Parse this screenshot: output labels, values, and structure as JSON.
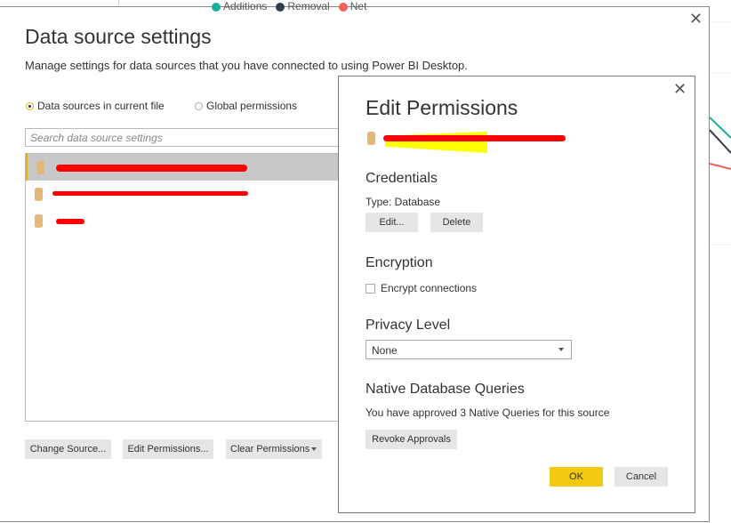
{
  "background": {
    "legend": [
      {
        "label": "Additions",
        "color": "#1aaf9c"
      },
      {
        "label": "Removal",
        "color": "#333d47"
      },
      {
        "label": "Net",
        "color": "#f0605a"
      }
    ]
  },
  "dialog": {
    "title": "Data source settings",
    "description": "Manage settings for data sources that you have connected to using Power BI Desktop.",
    "radios": [
      {
        "label": "Data sources in current file",
        "selected": true
      },
      {
        "label": "Global permissions",
        "selected": false
      }
    ],
    "search_placeholder": "Search data source settings",
    "sources": [
      {
        "selected": true
      },
      {
        "selected": false
      },
      {
        "selected": false
      }
    ],
    "buttons": {
      "change_source": "Change Source...",
      "edit_permissions": "Edit Permissions...",
      "clear_permissions": "Clear Permissions"
    }
  },
  "edit": {
    "title": "Edit Permissions",
    "credentials": {
      "heading": "Credentials",
      "type": "Type: Database",
      "edit": "Edit...",
      "delete": "Delete"
    },
    "encryption": {
      "heading": "Encryption",
      "checkbox": "Encrypt connections",
      "checked": false
    },
    "privacy": {
      "heading": "Privacy Level",
      "value": "None"
    },
    "native": {
      "heading": "Native Database Queries",
      "text": "You have approved 3 Native Queries for this source",
      "revoke": "Revoke Approvals"
    },
    "ok": "OK",
    "cancel": "Cancel",
    "accent": "#f2c811"
  }
}
